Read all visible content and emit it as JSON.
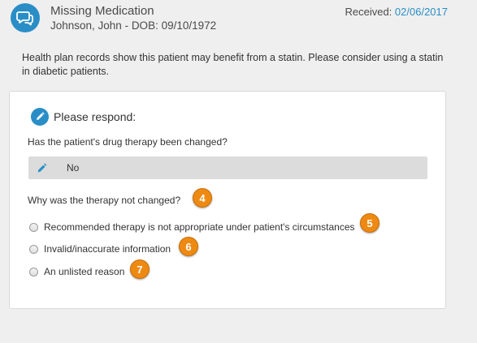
{
  "alert": {
    "title": "Missing Medication",
    "patient": "Johnson, John - DOB: 09/10/1972",
    "received_label": "Received:",
    "received_date": "02/06/2017",
    "message": "Health plan records show this patient may benefit from a statin. Please consider using a statin in diabetic patients."
  },
  "response": {
    "heading": "Please respond:",
    "question1": "Has the patient's drug therapy been changed?",
    "answer1": "No",
    "question2": "Why was the therapy not changed?",
    "options": [
      {
        "label": "Recommended therapy is not appropriate under patient's circumstances",
        "selected": false
      },
      {
        "label": "Invalid/inaccurate information",
        "selected": false
      },
      {
        "label": "An unlisted reason",
        "selected": false
      }
    ]
  },
  "callouts": {
    "question2": "4",
    "option1": "5",
    "option2": "6",
    "option3": "7"
  },
  "colors": {
    "accent": "#2a8ec6",
    "callout": "#ee8a12",
    "background": "#efefef",
    "answer_bar": "#dcdcdc"
  },
  "icons": {
    "header": "chat-bubbles-icon",
    "respond": "pencil-icon",
    "edit": "pencil-icon"
  }
}
